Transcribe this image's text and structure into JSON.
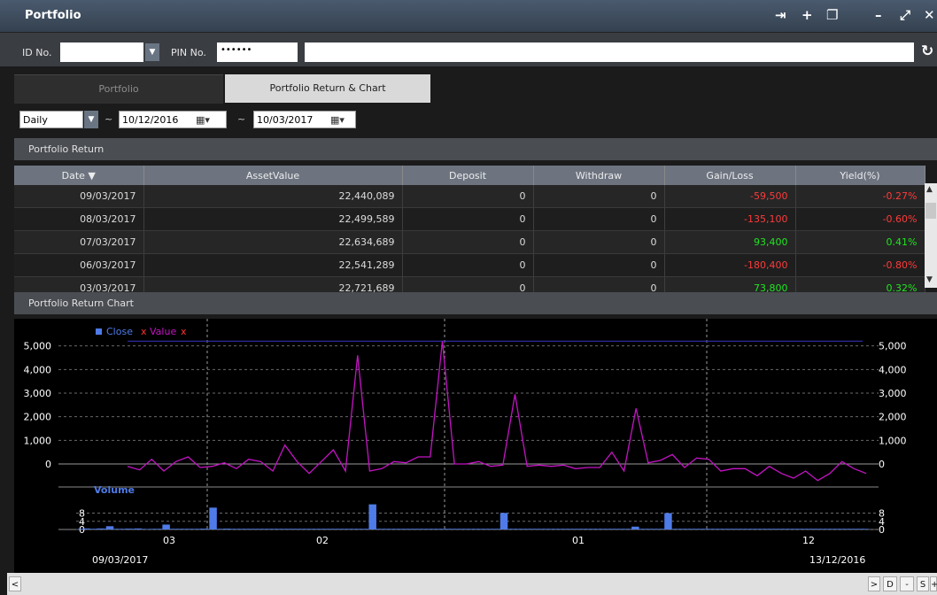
{
  "window": {
    "title": "Portfolio"
  },
  "account": {
    "id_label": "ID No.",
    "pin_label": "PIN No.",
    "pin_value": "••••••"
  },
  "tabs": [
    {
      "label": "Portfolio"
    },
    {
      "label": "Portfolio Return & Chart"
    }
  ],
  "filters": {
    "period": "Daily",
    "from_date": "10/12/2016",
    "to_date": "10/03/2017",
    "from_sep": "~",
    "to_sep": "~"
  },
  "return_section": {
    "title": "Portfolio Return"
  },
  "table": {
    "headers": [
      "Date ▼",
      "AssetValue",
      "Deposit",
      "Withdraw",
      "Gain/Loss",
      "Yield(%)"
    ],
    "rows": [
      {
        "date": "09/03/2017",
        "asset": "22,440,089",
        "deposit": "0",
        "withdraw": "0",
        "gain": "-59,500",
        "yield": "-0.27%",
        "sign": "neg"
      },
      {
        "date": "08/03/2017",
        "asset": "22,499,589",
        "deposit": "0",
        "withdraw": "0",
        "gain": "-135,100",
        "yield": "-0.60%",
        "sign": "neg"
      },
      {
        "date": "07/03/2017",
        "asset": "22,634,689",
        "deposit": "0",
        "withdraw": "0",
        "gain": "93,400",
        "yield": "0.41%",
        "sign": "pos"
      },
      {
        "date": "06/03/2017",
        "asset": "22,541,289",
        "deposit": "0",
        "withdraw": "0",
        "gain": "-180,400",
        "yield": "-0.80%",
        "sign": "neg"
      },
      {
        "date": "03/03/2017",
        "asset": "22,721,689",
        "deposit": "0",
        "withdraw": "0",
        "gain": "73,800",
        "yield": "0.32%",
        "sign": "pos"
      }
    ]
  },
  "chart_section": {
    "title": "Portfolio Return Chart"
  },
  "chart_data": {
    "type": "line",
    "legend": [
      "Close x",
      "Value x"
    ],
    "y_ticks": [
      0,
      1000,
      2000,
      3000,
      4000,
      5000
    ],
    "y_tick_labels": [
      "0",
      "1,000",
      "2,000",
      "3,000",
      "4,000",
      "5,000"
    ],
    "ylim": [
      -900,
      5700
    ],
    "close_level": 5200,
    "series": [
      {
        "name": "Value x",
        "values": [
          -100,
          -250,
          200,
          -300,
          100,
          300,
          -150,
          -100,
          50,
          -200,
          200,
          100,
          -300,
          800,
          100,
          -400,
          100,
          600,
          -300,
          4600,
          -300,
          -200,
          100,
          50,
          300,
          300,
          5200,
          0,
          0,
          100,
          -100,
          -50,
          2950,
          -100,
          -50,
          -100,
          -50,
          -200,
          -150,
          -150,
          500,
          -300,
          2350,
          50,
          150,
          400,
          -150,
          250,
          200,
          -300,
          -200,
          -200,
          -500,
          -100,
          -400,
          -600,
          -300,
          -700,
          -400,
          100,
          -200,
          -400
        ]
      }
    ],
    "volume": {
      "label": "Volume",
      "y_ticks": [
        0,
        4,
        8
      ],
      "bars": [
        0.3,
        0.5,
        0.3,
        0.3,
        0.5,
        0.4,
        1.6,
        0.3,
        0.3,
        0.3,
        0.4,
        0.3,
        0.5,
        0.3,
        0.2,
        0.3,
        0.3,
        0.3,
        2.4,
        0.3,
        0.3,
        0.3,
        0.3,
        0.3,
        0.3,
        0.3,
        0.4,
        0.3,
        10.7,
        0.3,
        0.3,
        0.4,
        0.3,
        0.3,
        0.3,
        0.3,
        0.3,
        0.3,
        0.3,
        0.3,
        0.3,
        0.3,
        0.3,
        0.3,
        0.3,
        0.3,
        0.3,
        0.3,
        0.3,
        0.3,
        0.3,
        0.3,
        0.3,
        0.3,
        0.3,
        0.3,
        0.3,
        0.3,
        0.3,
        0.3,
        0.3,
        0.3,
        12.3,
        0.3,
        0.3,
        0.3,
        0.3,
        0.3,
        0.3,
        0.3,
        0.3,
        0.3,
        0.3,
        0.3,
        0.3,
        0.3,
        0.3,
        0.3,
        0.3,
        0.3,
        0.3,
        0.3,
        0.3,
        0.3,
        0.3,
        0.3,
        0.3,
        0.3,
        0.3,
        0.3,
        8.1,
        0.3,
        0.3,
        0.3,
        0.3,
        0.3,
        0.3,
        0.3,
        0.3,
        0.3,
        0.3,
        0.3,
        0.3,
        0.3,
        0.3,
        0.3,
        0.3,
        0.3,
        0.3,
        0.3,
        0.3,
        0.3,
        0.3,
        0.3,
        0.3,
        0.3,
        0.3,
        0.3,
        1.4,
        0.3,
        0.3,
        0.3,
        0.3,
        0.3,
        0.3,
        8.0,
        0.3,
        0.3,
        0.3,
        0.3,
        0.3,
        0.3,
        0.3,
        0.3,
        0.3,
        0.3,
        0.3,
        0.3,
        0.3,
        0.3,
        0.3,
        0.3,
        0.3,
        0.3,
        0.3,
        0.3,
        0.3,
        0.3,
        0.3,
        0.3,
        0.3,
        0.3,
        0.3,
        0.3,
        0.3,
        0.3,
        0.3,
        0.3,
        0.3,
        0.3,
        0.3,
        0.3,
        0.3,
        0.3,
        0.3,
        0.3,
        0.3,
        0.3
      ]
    },
    "x_ticks": [
      "03",
      "02",
      "01",
      "12"
    ],
    "x_start_label": "09/03/2017",
    "x_end_label": "13/12/2016"
  },
  "scroll": {
    "left": "<",
    "right": ">",
    "d": "D",
    "minus": "-",
    "s": "S",
    "plus": "+"
  },
  "colors": {
    "accent": "#4f7be8",
    "value_line": "#c414c4",
    "close_line": "#3030b0",
    "negative": "#ff3a3a",
    "positive": "#1fe61f"
  }
}
